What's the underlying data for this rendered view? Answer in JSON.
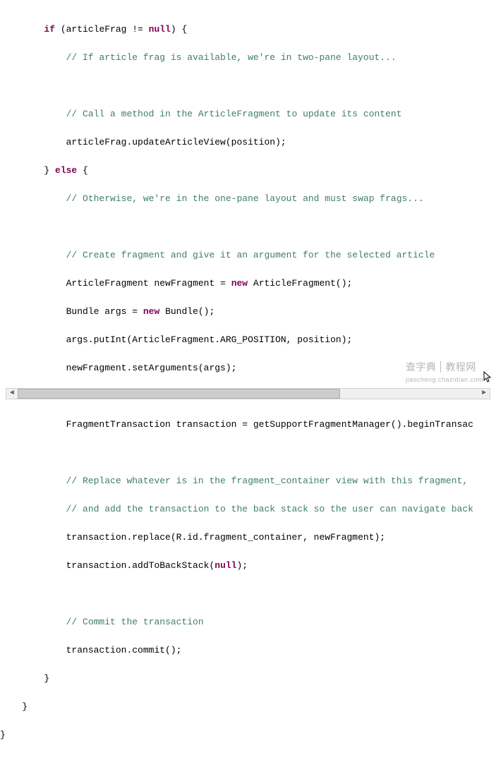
{
  "indent": {
    "l2": "        ",
    "l3": "            ",
    "l4": "                ",
    "l1": "    ",
    "l0": ""
  },
  "code": {
    "if_kw": "if",
    "cond_open": " (articleFrag != ",
    "null_kw": "null",
    "cond_close": ") {",
    "cmt_twopane": "// If article frag is available, we're in two-pane layout...",
    "cmt_call": "// Call a method in the ArticleFragment to update its content",
    "call_update": "articleFrag.updateArticleView(position);",
    "else_close": "} ",
    "else_kw": "else",
    "else_open": " {",
    "cmt_onepane": "// Otherwise, we're in the one-pane layout and must swap frags...",
    "cmt_create": "// Create fragment and give it an argument for the selected article",
    "type_af": "ArticleFragment",
    "var_nf": " newFragment = ",
    "new_kw": "new",
    "ctor_af": " ArticleFragment();",
    "type_bundle": "Bundle",
    "var_args": " args = ",
    "ctor_bundle": " Bundle();",
    "putint": "args.putInt(ArticleFragment.ARG_POSITION, position);",
    "setargs": "newFragment.setArguments(args);",
    "type_ft": "FragmentTransaction",
    "var_tx": " transaction = getSupportFragmentManager().beginTransac",
    "cmt_replace1": "// Replace whatever is in the fragment_container view with this fragment,",
    "cmt_replace2": "// and add the transaction to the back stack so the user can navigate back",
    "tx_replace": "transaction.replace(R.id.fragment_container, newFragment);",
    "tx_addback_pre": "transaction.addToBackStack(",
    "tx_addback_post": ");",
    "cmt_commit": "// Commit the transaction",
    "tx_commit": "transaction.commit();",
    "brace_close": "}",
    "brace_close2": "}",
    "brace_close3": "}"
  },
  "watermark": {
    "left": "查字典",
    "right": "教程网",
    "sub": "jiaocheng.chazidian.com"
  },
  "scrollbar": {
    "left_arrow": "◄",
    "right_arrow": "►"
  }
}
